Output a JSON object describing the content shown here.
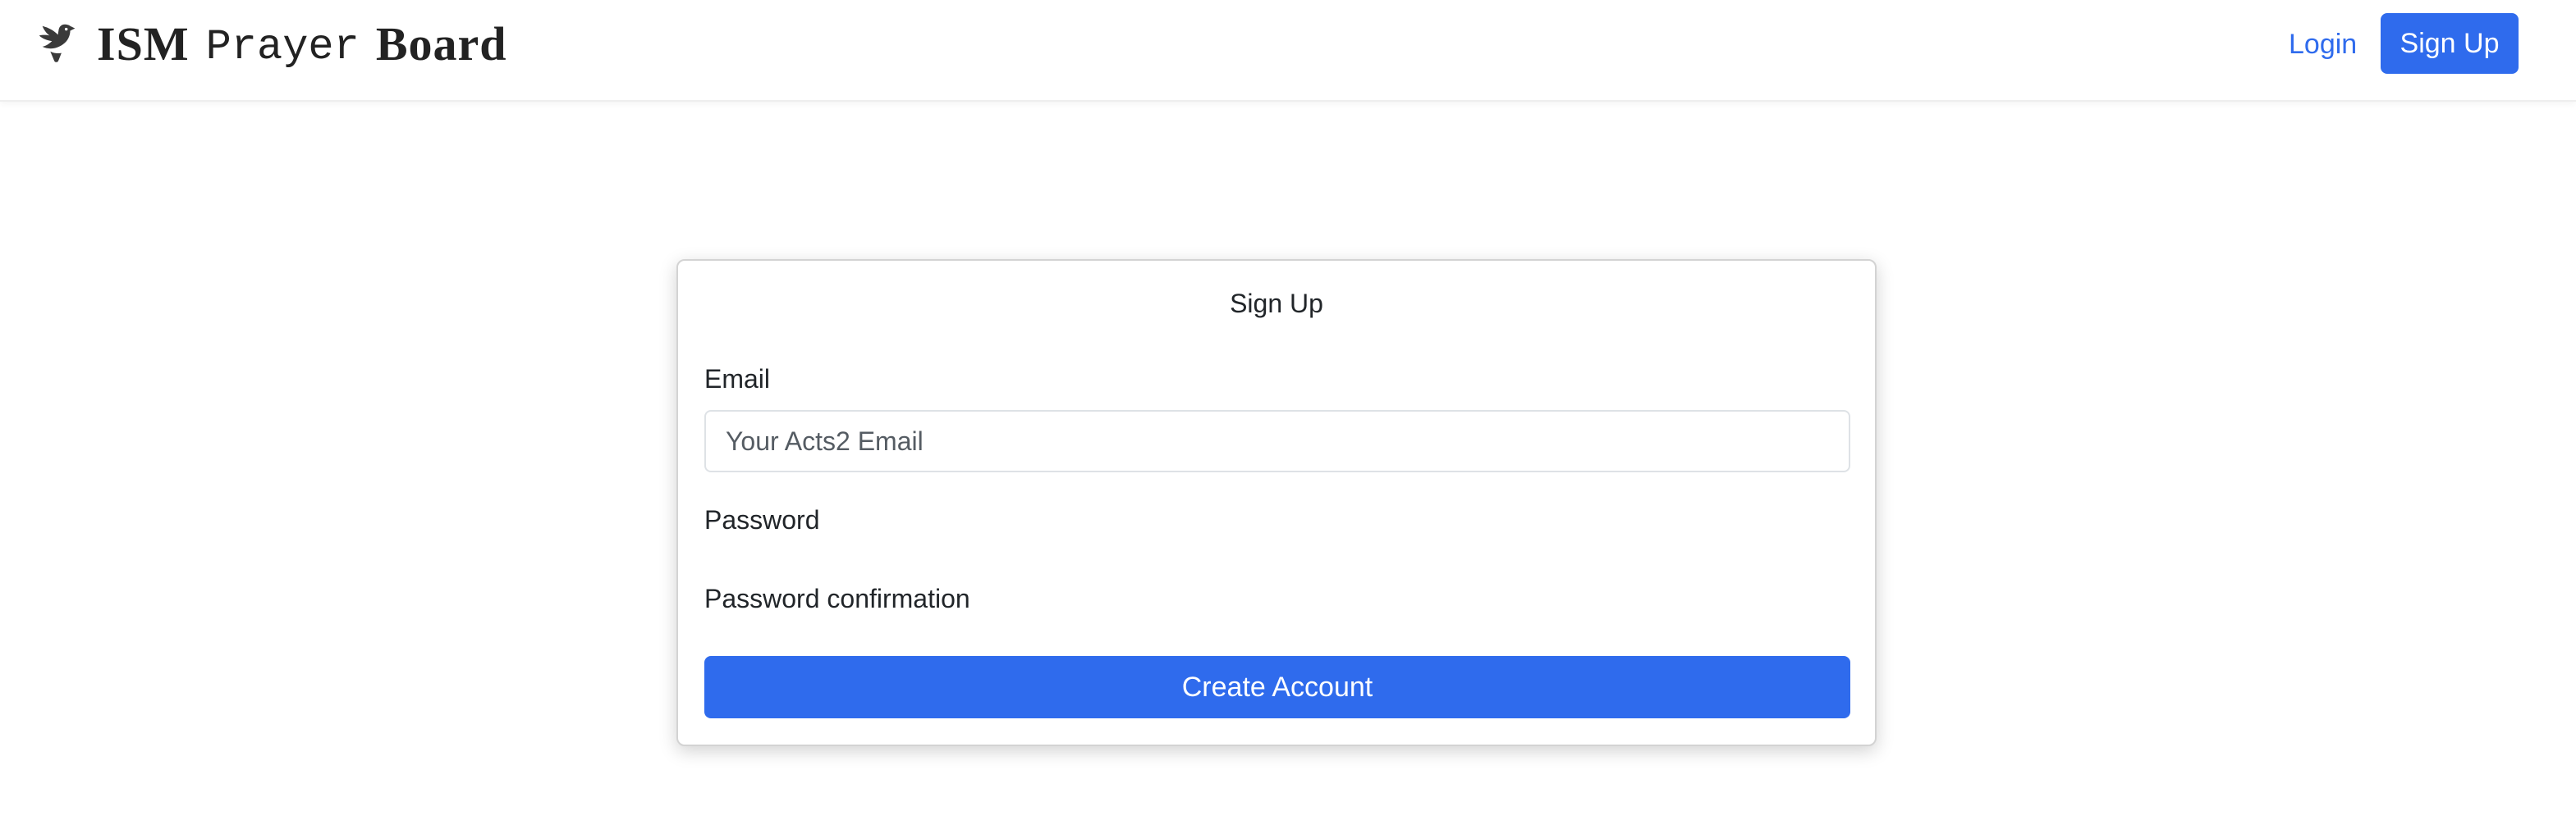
{
  "navbar": {
    "brand": {
      "icon": "dove-icon",
      "word1": "ISM",
      "word2": "Prayer",
      "word3": "Board"
    },
    "login_label": "Login",
    "signup_label": "Sign Up"
  },
  "signup_form": {
    "title": "Sign Up",
    "email_label": "Email",
    "email_placeholder": "Your Acts2 Email",
    "email_value": "",
    "password_label": "Password",
    "password_confirmation_label": "Password confirmation",
    "submit_label": "Create Account"
  },
  "colors": {
    "primary": "#2f6bed",
    "brand_text": "#222222"
  }
}
